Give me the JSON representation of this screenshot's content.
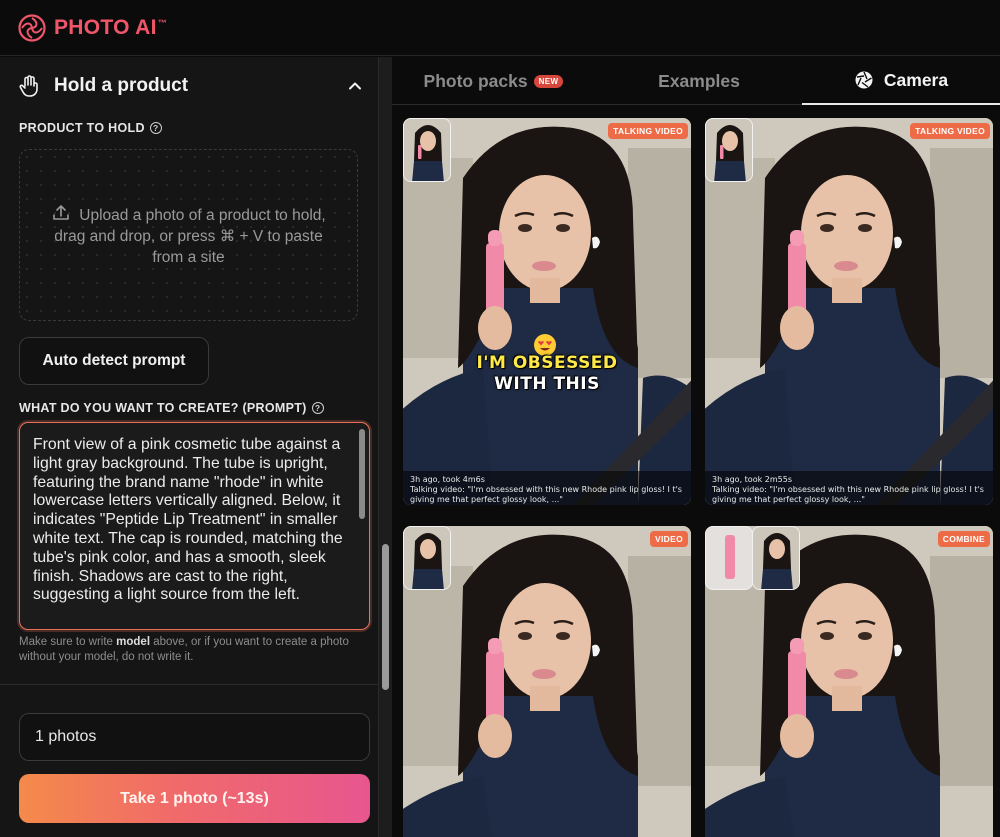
{
  "app": {
    "logo_text": "PHOTO AI",
    "logo_mark": "™",
    "accent": "#f0566a"
  },
  "left": {
    "section_title": "Hold a product",
    "product_label": "PRODUCT TO HOLD",
    "dropzone_text": "Upload a photo of a product to hold, drag and drop, or press ⌘ + V to paste from a site",
    "auto_detect_label": "Auto detect prompt",
    "prompt_label": "WHAT DO YOU WANT TO CREATE? (PROMPT)",
    "prompt_value": "Front view of a pink cosmetic tube against a light gray background. The tube is upright, featuring the brand name \"rhode\" in white lowercase letters vertically aligned. Below, it indicates \"Peptide Lip Treatment\" in smaller white text. The cap is rounded, matching the tube's pink color, and has a smooth, sleek finish. Shadows are cast to the right, suggesting a light source from the left.",
    "hint_part1": "Make sure to write ",
    "hint_bold": "model",
    "hint_part2": " above, or if you want to create a photo without your model, do not write it.",
    "photos_count": "1 photos",
    "take_button": "Take 1 photo (~13s)"
  },
  "tabs": {
    "photo_packs": "Photo packs",
    "new_badge": "NEW",
    "examples": "Examples",
    "camera": "Camera"
  },
  "cards": [
    {
      "tag": "TALKING VIDEO",
      "overlay_line1": "I'M OBSESSED",
      "overlay_line2": "WITH THIS",
      "meta": "3h ago, took 4m6s",
      "caption": "Talking video: \"I'm obsessed with this new Rhode pink lip gloss! I t's giving me that perfect glossy look, ...\""
    },
    {
      "tag": "TALKING VIDEO",
      "meta": "3h ago, took 2m55s",
      "caption": "Talking video: \"I'm obsessed with this new Rhode pink lip gloss! I t's giving me that perfect glossy look, ...\""
    },
    {
      "tag": "VIDEO"
    },
    {
      "tag": "COMBINE"
    }
  ]
}
